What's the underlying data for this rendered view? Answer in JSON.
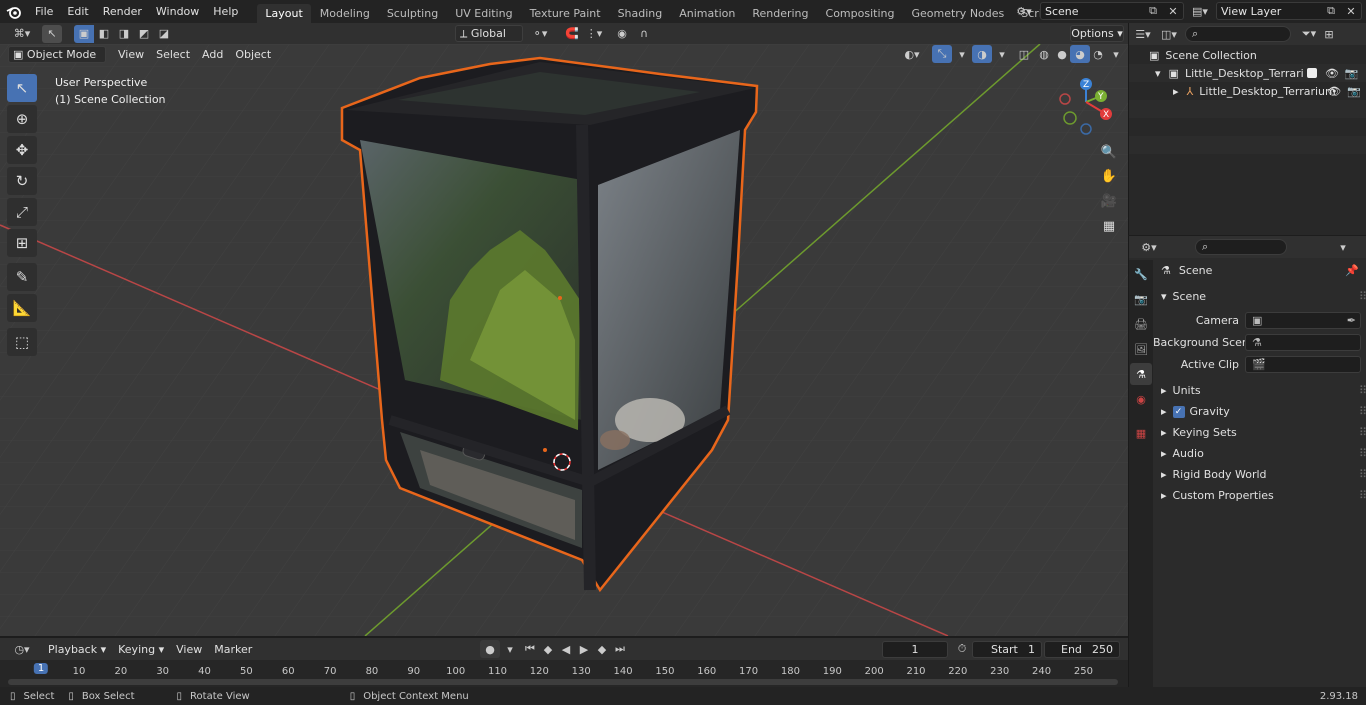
{
  "app": {
    "menus": [
      "File",
      "Edit",
      "Render",
      "Window",
      "Help"
    ],
    "workspaces": [
      "Layout",
      "Modeling",
      "Sculpting",
      "UV Editing",
      "Texture Paint",
      "Shading",
      "Animation",
      "Rendering",
      "Compositing",
      "Geometry Nodes",
      "Scripting"
    ],
    "active_workspace": "Layout",
    "scene_name": "Scene",
    "view_layer": "View Layer",
    "version": "2.93.18"
  },
  "viewport": {
    "mode": "Object Mode",
    "menus": [
      "View",
      "Select",
      "Add",
      "Object"
    ],
    "transform_orientation": "Global",
    "options_label": "Options",
    "perspective_label": "User Perspective",
    "collection_label": "(1) Scene Collection"
  },
  "outliner": {
    "root": "Scene Collection",
    "collection": "Little_Desktop_Terrarium_witl",
    "object": "Little_Desktop_Terrarium"
  },
  "properties": {
    "context": "Scene",
    "panel": "Scene",
    "camera_label": "Camera",
    "background_scene_label": "Background Scene",
    "active_clip_label": "Active Clip",
    "subpanels": [
      "Units",
      "Gravity",
      "Keying Sets",
      "Audio",
      "Rigid Body World",
      "Custom Properties"
    ],
    "gravity_checked": true
  },
  "timeline": {
    "menus": [
      "Playback",
      "Keying",
      "View",
      "Marker"
    ],
    "current_frame": "1",
    "start_label": "Start",
    "start": "1",
    "end_label": "End",
    "end": "250",
    "ticks": [
      "1",
      "10",
      "20",
      "30",
      "40",
      "50",
      "60",
      "70",
      "80",
      "90",
      "100",
      "110",
      "120",
      "130",
      "140",
      "150",
      "160",
      "170",
      "180",
      "190",
      "200",
      "210",
      "220",
      "230",
      "240",
      "250"
    ]
  },
  "statusbar": {
    "select": "Select",
    "box_select": "Box Select",
    "rotate_view": "Rotate View",
    "context_menu": "Object Context Menu"
  },
  "colors": {
    "accent": "#4772b3",
    "selection_outline": "#e8661b",
    "axis_x": "#e23c3c",
    "axis_y": "#7ab032",
    "axis_z": "#3b82d6"
  }
}
